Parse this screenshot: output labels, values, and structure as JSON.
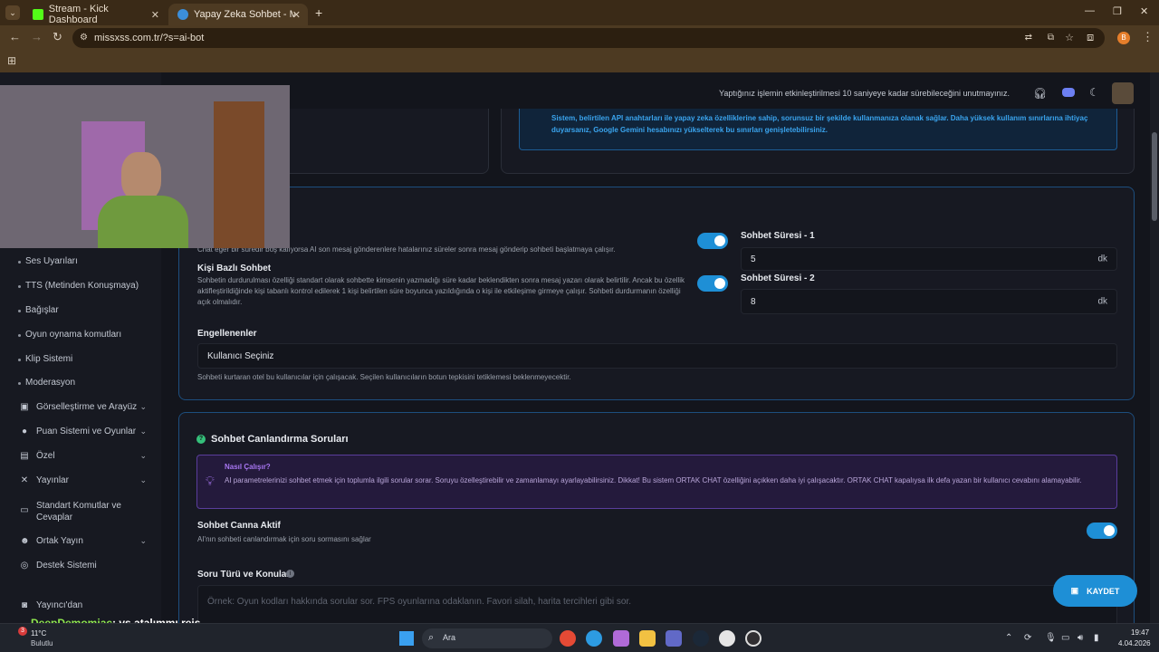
{
  "browser": {
    "tabs": [
      {
        "title": "Stream - Kick Dashboard"
      },
      {
        "title": "Yapay Zeka Sohbet - MissXss Al"
      }
    ],
    "new_tab": "+",
    "url": "missxss.com.tr/?s=ai-bot",
    "profile_initial": "B"
  },
  "header": {
    "notice": "Yaptığınız işlemin etkinleştirilmesi 10 saniyeye kadar sürebileceğini unutmayınız."
  },
  "info_box": {
    "text": "Sistem, belirtilen API anahtarları ile yapay zeka özelliklerine sahip, sorunsuz bir şekilde kullanmanıza olanak sağlar. Daha yüksek kullanım sınırlarına ihtiyaç duyarsanız, Google Gemini hesabınızı yükselterek bu sınırları genişletebilirsiniz."
  },
  "sidebar": {
    "sub_items": [
      "Ses Uyarıları",
      "TTS (Metinden Konuşmaya)",
      "Bağışlar",
      "Oyun oynama komutları",
      "Klip Sistemi",
      "Moderasyon"
    ],
    "items": [
      {
        "label": "Görselleştirme ve Arayüz"
      },
      {
        "label": "Puan Sistemi ve Oyunlar"
      },
      {
        "label": "Özel"
      },
      {
        "label": "Yayınlar"
      },
      {
        "label": "Standart Komutlar ve Cevaplar"
      },
      {
        "label": "Ortak Yayın"
      },
      {
        "label": "Destek Sistemi"
      },
      {
        "label": "Yayıncı'dan"
      }
    ]
  },
  "chat_settings": {
    "partial_desc": "Chat eğer bir süredir boş kalıyorsa AI son mesaj gönderenlere hatalarınız süreler sonra mesaj gönderip sohbeti başlatmaya çalışır.",
    "kisi_bazli": {
      "title": "Kişi Bazlı Sohbet",
      "desc": "Sohbetin durdurulması özelliği standart olarak sohbette kimsenin yazmadığı süre kadar beklendikten sonra mesaj yazarı olarak belirtilir. Ancak bu özellik aktifleştirildiğinde kişi tabanlı kontrol edilerek 1 kişi belirtilen süre boyunca yazıldığında o kişi ile etkileşime girmeye çalışır. Sohbeti durdurmanın özelliği açık olmalıdır."
    },
    "sure1": {
      "label": "Sohbet Süresi - 1",
      "value": "5",
      "unit": "dk"
    },
    "sure2": {
      "label": "Sohbet Süresi - 2",
      "value": "8",
      "unit": "dk"
    },
    "engellenenler": {
      "label": "Engellenenler",
      "placeholder": "Kullanıcı Seçiniz",
      "desc": "Sohbeti kurtaran otel bu kullanıcılar için çalışacak. Seçilen kullanıcıların botun tepkisini tetiklemesi beklenmeyecektir."
    }
  },
  "revive": {
    "title": "Sohbet Canlandırma Soruları",
    "how_title": "Nasıl Çalışır?",
    "how_text": "AI parametrelerinizi sohbet etmek için toplumla ilgili sorular sorar. Soruyu özelleştirebilir ve zamanlamayı ayarlayabilirsiniz. Dikkat! Bu sistem ORTAK CHAT özelliğini açıkken daha iyi çalışacaktır. ORTAK CHAT kapalıysa ilk defa yazan bir kullanıcı cevabını alamayabilir.",
    "active_label": "Sohbet Canna Aktif",
    "active_desc": "AI'nın sohbeti canlandırmak için soru sormasını sağlar",
    "topics_label": "Soru Türü ve Konuları",
    "topics_placeholder": "Örnek: Oyun kodları hakkında sorular sor. FPS oyunlarına odaklanın. Favori silah, harita tercihleri gibi sor."
  },
  "save_button": "KAYDET",
  "overlay_chat": {
    "user": "DeepDemomiac",
    "message": ": vs atalımmı reis"
  },
  "taskbar": {
    "weather_temp": "11°C",
    "weather_desc": "Bulutlu",
    "weather_badge": "3",
    "search_placeholder": "Ara",
    "time": "19:47",
    "date": "4.04.2026"
  }
}
